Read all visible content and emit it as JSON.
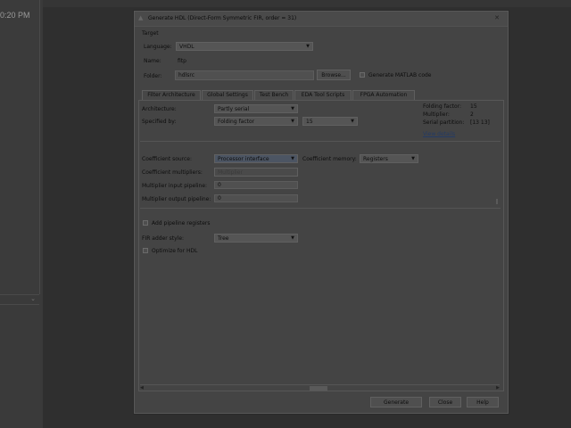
{
  "background": {
    "time_text": "0:20 PM"
  },
  "dialog": {
    "title": "Generate HDL (Direct-Form Symmetric FIR, order = 31)",
    "target": {
      "section_label": "Target",
      "language_label": "Language:",
      "language_value": "VHDL",
      "name_label": "Name:",
      "name_value": "fitp",
      "folder_label": "Folder:",
      "folder_value": "hdlsrc",
      "browse_label": "Browse...",
      "matlab_code_label": "Generate MATLAB code"
    },
    "tabs": [
      {
        "label": "Filter Architecture"
      },
      {
        "label": "Global Settings"
      },
      {
        "label": "Test Bench"
      },
      {
        "label": "EDA Tool Scripts"
      },
      {
        "label": "FPGA Automation"
      }
    ],
    "filter_architecture": {
      "architecture_label": "Architecture:",
      "architecture_value": "Partly serial",
      "specified_by_label": "Specified by:",
      "specified_by_value": "Folding factor",
      "folding_value": "15",
      "info": {
        "folding_factor_label": "Folding factor:",
        "folding_factor_value": "15",
        "multiplier_label": "Multiplier:",
        "multiplier_value": "2",
        "serial_partition_label": "Serial partition:",
        "serial_partition_value": "[13 13]",
        "view_details": "View details"
      },
      "coefficient_source_label": "Coefficient source:",
      "coefficient_source_value": "Processor interface",
      "coefficient_memory_label": "Coefficient memory:",
      "coefficient_memory_value": "Registers",
      "coefficient_multipliers_label": "Coefficient multipliers:",
      "coefficient_multipliers_value": "Multiplier",
      "multiplier_input_pipeline_label": "Multiplier input pipeline:",
      "multiplier_input_pipeline_value": "0",
      "multiplier_output_pipeline_label": "Multiplier output pipeline:",
      "multiplier_output_pipeline_value": "0",
      "add_pipeline_registers_label": "Add pipeline registers",
      "fir_adder_style_label": "FIR adder style:",
      "fir_adder_style_value": "Tree",
      "optimize_for_hdl_label": "Optimize for HDL"
    },
    "buttons": {
      "generate": "Generate",
      "close": "Close",
      "help": "Help"
    }
  }
}
